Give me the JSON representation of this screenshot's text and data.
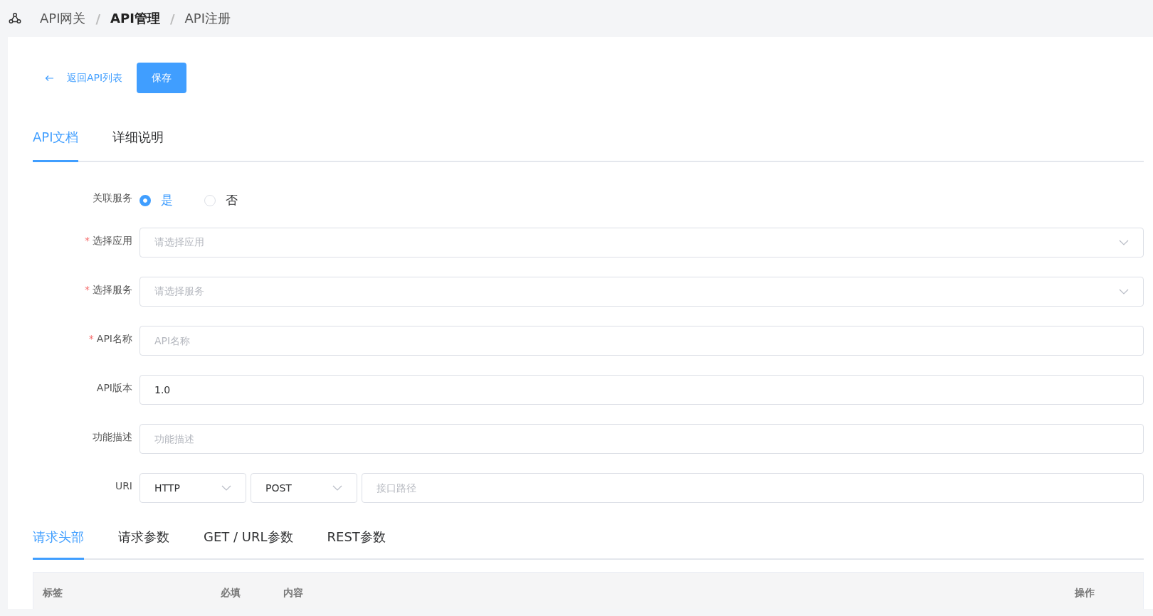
{
  "breadcrumb": [
    {
      "label": "API网关",
      "selected": false
    },
    {
      "separator": "/",
      "label": "API管理",
      "selected": true
    },
    {
      "separator": "/",
      "label": "API注册",
      "selected": false
    }
  ],
  "toolbar": {
    "back_link": "返回API列表",
    "save_button": "保存"
  },
  "tabs": [
    {
      "label": "API文档",
      "selected": true
    },
    {
      "label": "详细说明",
      "selected": false
    }
  ],
  "form": [
    {
      "kind": "radio",
      "label": "关联服务",
      "options": [
        {
          "label": "是",
          "selected": true
        },
        {
          "label": "否",
          "selected": false
        }
      ]
    },
    {
      "kind": "select",
      "required_mark": "*",
      "label": "选择应用",
      "placeholder": "请选择应用"
    },
    {
      "kind": "select",
      "required_mark": "*",
      "label": "选择服务",
      "placeholder": "请选择服务"
    },
    {
      "kind": "input",
      "required_mark": "*",
      "label": "API名称",
      "placeholder": "API名称"
    },
    {
      "kind": "input",
      "label": "API版本",
      "value": "1.0"
    },
    {
      "kind": "input",
      "label": "功能描述",
      "placeholder": "功能描述"
    },
    {
      "kind": "uri",
      "label": "URI",
      "protocol": "HTTP",
      "method": "POST",
      "placeholder": "接口路径"
    }
  ],
  "param_tabs": [
    {
      "label": "请求头部",
      "selected": true
    },
    {
      "label": "请求参数",
      "selected": false
    },
    {
      "label": "GET / URL参数",
      "selected": false
    },
    {
      "label": "REST参数",
      "selected": false
    }
  ],
  "table": {
    "columns": [
      "标签",
      "必填",
      "内容",
      "操作"
    ]
  }
}
